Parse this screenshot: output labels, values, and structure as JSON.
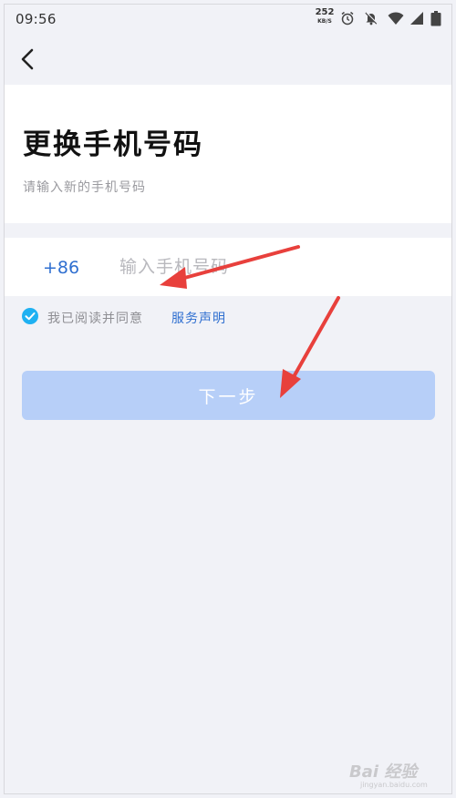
{
  "status_bar": {
    "time": "09:56",
    "net_speed_value": "252",
    "net_speed_unit": "KB/S",
    "icons": [
      "alarm-icon",
      "notifications-off-icon",
      "wifi-icon",
      "signal-icon",
      "battery-icon"
    ]
  },
  "nav": {
    "back_icon": "chevron-left-icon"
  },
  "header": {
    "title": "更换手机号码",
    "subtitle": "请输入新的手机号码"
  },
  "phone": {
    "country_code": "+86",
    "placeholder": "输入手机号码",
    "value": ""
  },
  "agreement": {
    "checked": true,
    "text": "我已阅读并同意",
    "link_label": "服务声明"
  },
  "next_button": {
    "label": "下一步",
    "enabled": false
  },
  "watermark": {
    "text": "Bai 经验",
    "sub": "jingyan.baidu.com"
  },
  "colors": {
    "accent": "#2f6fd0",
    "check": "#1fb1f2",
    "button_disabled": "#b7cff8",
    "background": "#f1f2f7",
    "annotation_arrow": "#e8403c"
  }
}
